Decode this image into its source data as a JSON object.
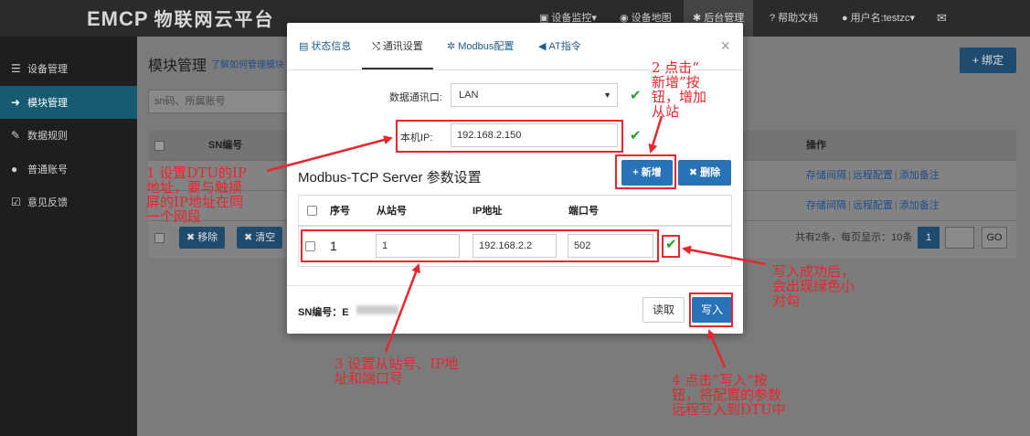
{
  "app": {
    "logo": "EMCP",
    "logo_cn": "物联网云平台"
  },
  "topnav": [
    {
      "icon": "monitor-icon",
      "glyph": "▣",
      "label": "设备监控",
      "caret": "▾"
    },
    {
      "icon": "globe-icon",
      "glyph": "◉",
      "label": "设备地图",
      "caret": ""
    },
    {
      "icon": "gears-icon",
      "glyph": "✱",
      "label": "后台管理",
      "caret": ""
    },
    {
      "icon": "question-icon",
      "glyph": "?",
      "label": "帮助文档",
      "caret": ""
    },
    {
      "icon": "user-icon",
      "glyph": "●",
      "label": "用户名:testzc",
      "caret": "▾"
    },
    {
      "icon": "envelope-icon",
      "glyph": "✉",
      "label": "",
      "caret": ""
    }
  ],
  "sidebar": {
    "items": [
      {
        "icon": "list-icon",
        "glyph": "☰",
        "label": "设备管理"
      },
      {
        "icon": "sign-in-icon",
        "glyph": "➜",
        "label": "模块管理"
      },
      {
        "icon": "pencil-icon",
        "glyph": "✎",
        "label": "数据规则"
      },
      {
        "icon": "user-icon",
        "glyph": "●",
        "label": "普通账号"
      },
      {
        "icon": "edit-icon",
        "glyph": "☑",
        "label": "意见反馈"
      }
    ]
  },
  "page": {
    "title": "模块管理",
    "help_link": "了解如何管理模块",
    "bind_button": "+ 绑定",
    "search_placeholder": "sn码、所属账号",
    "table": {
      "col_sn": "SN编号",
      "col_ops": "操作",
      "ops": [
        "存储间隔",
        "远程配置",
        "添加备注"
      ],
      "remove_button": "✖ 移除",
      "clear_button": "✖ 清空",
      "pager_text": "共有2条，每页显示：10条",
      "pager_page": "1",
      "pager_go": "GO"
    }
  },
  "modal": {
    "tabs": [
      {
        "icon": "status-icon",
        "glyph": "▤",
        "label": "状态信息"
      },
      {
        "icon": "shuffle-icon",
        "glyph": "⤭",
        "label": "通讯设置"
      },
      {
        "icon": "gear-icon",
        "glyph": "✲",
        "label": "Modbus配置"
      },
      {
        "icon": "send-icon",
        "glyph": "◀",
        "label": "AT指令"
      }
    ],
    "close": "×",
    "port_label": "数据通讯口:",
    "port_value": "LAN",
    "ip_label": "本机IP:",
    "ip_value": "192.168.2.150",
    "section_title": "Modbus-TCP Server 参数设置",
    "add_button": "+ 新增",
    "delete_button": "✖ 删除",
    "columns": [
      "序号",
      "从站号",
      "IP地址",
      "端口号"
    ],
    "row": {
      "index": "1",
      "slave": "1",
      "ip": "192.168.2.2",
      "port": "502"
    },
    "sn_label": "SN编号：E",
    "read_button": "读取",
    "write_button": "写入"
  },
  "annotations": {
    "a1": "1 设置DTU的IP\n地址，要与触摸\n屏的IP地址在同\n一个网段",
    "a2": "2 点击“\n新增”按\n钮，增加\n从站",
    "a3": "3 设置从站号、IP地\n址和端口号",
    "a4": "4 点击“写入”按\n钮，将配置的参数\n远程写入到DTU中",
    "a5": "写入成功后，\n会出现绿色小\n对勾"
  },
  "colors": {
    "annotation_red": "#e8262d",
    "primary_blue": "#2872b8",
    "success_green": "#1fa52d",
    "sidebar_active": "#175b73"
  }
}
